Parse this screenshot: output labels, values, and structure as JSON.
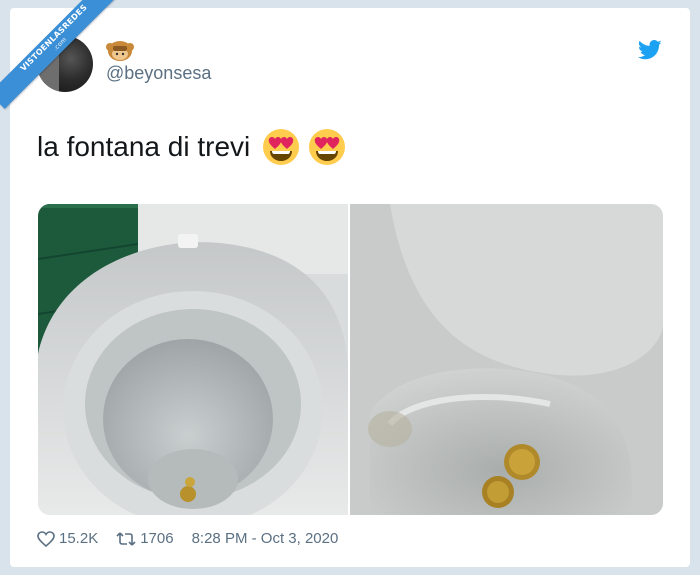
{
  "watermark": {
    "text": "VISTOENLASREDES",
    "sub": ".com"
  },
  "user": {
    "handle": "@beyonsesa",
    "name_emoji": "monkey-emoji"
  },
  "tweet": {
    "text": "la fontana di trevi",
    "emojis": [
      "heart-eyes-emoji",
      "heart-eyes-emoji"
    ]
  },
  "stats": {
    "likes": "15.2K",
    "retweets": "1706",
    "timestamp": "8:28 PM - Oct 3, 2020"
  },
  "colors": {
    "accent": "#1da1f2",
    "muted": "#5b7083",
    "background": "#d8e3ec",
    "text": "#14171a"
  },
  "icons": {
    "platform": "twitter-bird-icon",
    "like": "heart-icon",
    "retweet": "retweet-icon"
  }
}
